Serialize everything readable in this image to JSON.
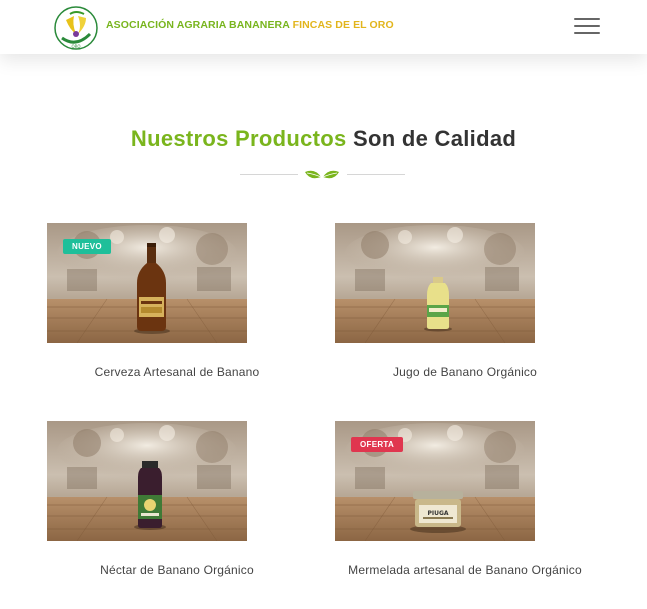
{
  "header": {
    "brand_part1": "ASOCIACIÓN AGRARIA BANANERA",
    "brand_part2": "FINCAS DE EL ORO",
    "menu_icon": "hamburger-menu-icon"
  },
  "section": {
    "title_highlight": "Nuestros Productos",
    "title_rest": "Son de Calidad",
    "divider_icon": "leaf-icon"
  },
  "products": [
    {
      "name": "Cerveza Artesanal de Banano",
      "badge": "NUEVO"
    },
    {
      "name": "Jugo de Banano Orgánico",
      "badge": ""
    },
    {
      "name": "Néctar de Banano Orgánico",
      "badge": ""
    },
    {
      "name": "Mermelada artesanal de Banano Orgánico",
      "badge": "OFERTA"
    }
  ],
  "colors": {
    "brand_green": "#78b51e",
    "brand_yellow": "#e2b51c",
    "badge_new": "#1fbf9a",
    "badge_offer": "#e0364f"
  }
}
